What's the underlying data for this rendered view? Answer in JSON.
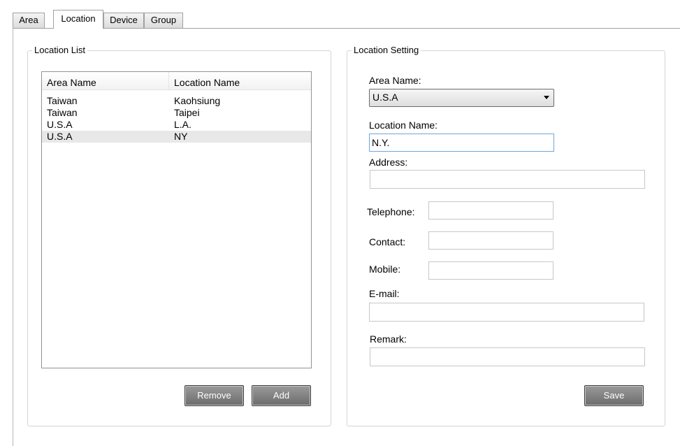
{
  "tabs": [
    {
      "label": "Area",
      "active": false
    },
    {
      "label": "Location",
      "active": true
    },
    {
      "label": "Device",
      "active": false
    },
    {
      "label": "Group",
      "active": false
    }
  ],
  "location_list": {
    "title": "Location List",
    "columns": [
      "Area Name",
      "Location Name"
    ],
    "rows": [
      {
        "area": "Taiwan",
        "location": "Kaohsiung",
        "selected": false
      },
      {
        "area": "Taiwan",
        "location": "Taipei",
        "selected": false
      },
      {
        "area": "U.S.A",
        "location": "L.A.",
        "selected": false
      },
      {
        "area": "U.S.A",
        "location": "NY",
        "selected": true
      }
    ],
    "remove_label": "Remove",
    "add_label": "Add"
  },
  "location_setting": {
    "title": "Location Setting",
    "area_name_label": "Area Name:",
    "area_name_value": "U.S.A",
    "location_name_label": "Location Name:",
    "location_name_value": "N.Y.",
    "address_label": "Address:",
    "address_value": "",
    "telephone_label": "Telephone:",
    "telephone_value": "",
    "contact_label": "Contact:",
    "contact_value": "",
    "mobile_label": "Mobile:",
    "mobile_value": "",
    "email_label": "E-mail:",
    "email_value": "",
    "remark_label": "Remark:",
    "remark_value": "",
    "save_label": "Save"
  }
}
